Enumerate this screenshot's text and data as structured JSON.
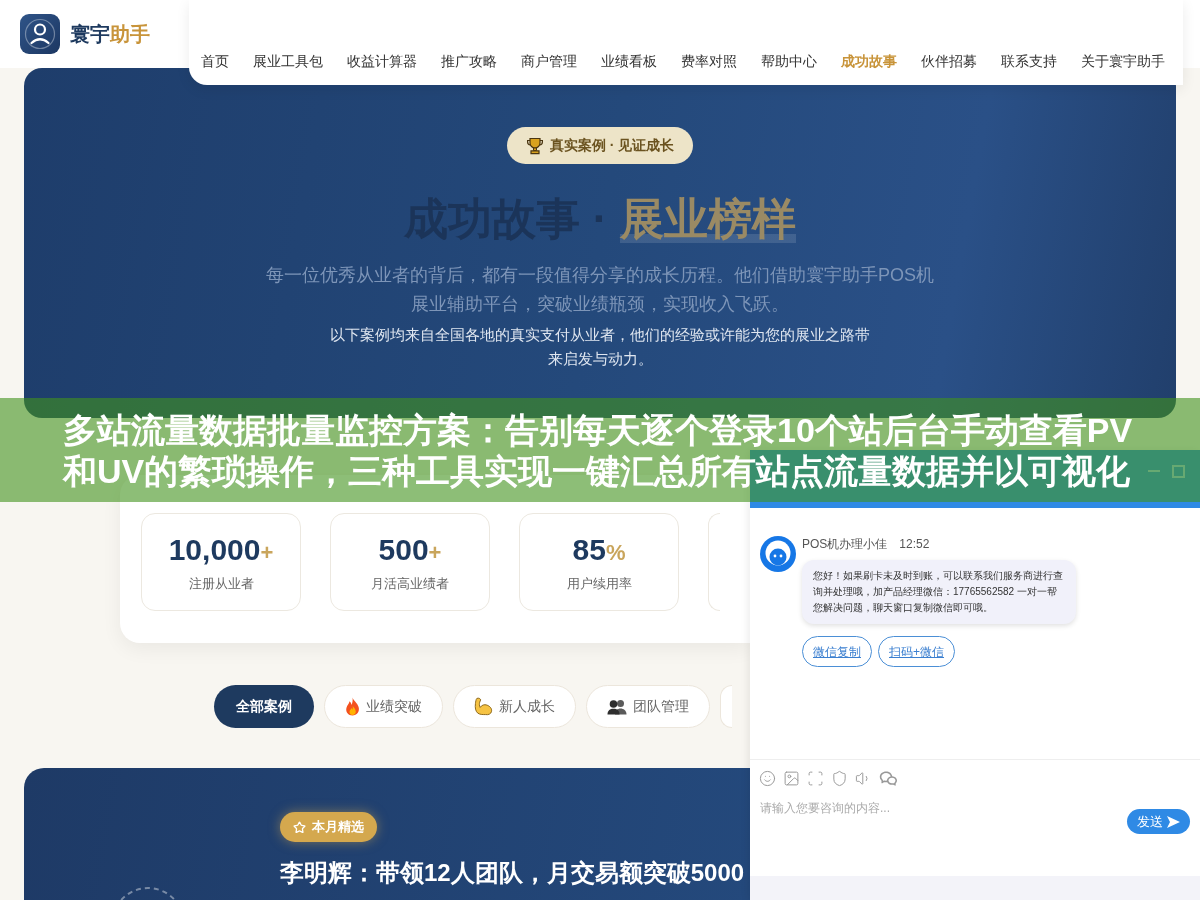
{
  "header": {
    "logo": {
      "main": "寰宇",
      "accent": "助手"
    },
    "nav": [
      {
        "label": "首页",
        "selected": false
      },
      {
        "label": "展业工具包",
        "selected": false
      },
      {
        "label": "收益计算器",
        "selected": false
      },
      {
        "label": "推广攻略",
        "selected": false
      },
      {
        "label": "商户管理",
        "selected": false
      },
      {
        "label": "业绩看板",
        "selected": false
      },
      {
        "label": "费率对照",
        "selected": false
      },
      {
        "label": "帮助中心",
        "selected": false
      },
      {
        "label": "成功故事",
        "selected": true
      },
      {
        "label": "伙伴招募",
        "selected": false
      },
      {
        "label": "联系支持",
        "selected": false
      },
      {
        "label": "关于寰宇助手",
        "selected": false
      }
    ]
  },
  "hero": {
    "badge": "真实案例 · 见证成长",
    "title": {
      "main": "成功故事 · ",
      "highlight": "展业榜样"
    },
    "subtitle": "每一位优秀从业者的背后，都有一段值得分享的成长历程。他们借助寰宇助手POS机展业辅助平台，突破业绩瓶颈，实现收入飞跃。",
    "note": "以下案例均来自全国各地的真实支付从业者，他们的经验或许能为您的展业之路带来启发与动力。"
  },
  "overlay_banner": {
    "title": "多站流量数据批量监控方案：告别每天逐个登录10个站后台手动查看PV和UV的繁琐操作，三种工具实现一键汇总所有站点流量数据并以可视化"
  },
  "stats": [
    {
      "value": "10,000",
      "suffix": "+",
      "label": "注册从业者"
    },
    {
      "value": "500",
      "suffix": "+",
      "label": "月活高业绩者"
    },
    {
      "value": "85",
      "suffix": "%",
      "label": "用户续用率"
    }
  ],
  "filters": [
    {
      "label": "全部案例",
      "selected": true
    },
    {
      "label": "业绩突破",
      "selected": false
    },
    {
      "label": "新人成长",
      "selected": false
    },
    {
      "label": "团队管理",
      "selected": false
    }
  ],
  "featured_story": {
    "badge": "本月精选",
    "title": "李明辉：带领12人团队，月交易额突破5000"
  },
  "chat": {
    "agent": "POS机办理小佳",
    "time": "12:52",
    "message": "您好！如果刷卡未及时到账，可以联系我们服务商进行查询并处理哦，加产品经理微信：17765562582 一对一帮您解决问题，聊天窗口复制微信即可哦。",
    "actions": [
      "微信复制",
      "扫码+微信"
    ],
    "placeholder": "请输入您要咨询的内容...",
    "send": "发送"
  }
}
